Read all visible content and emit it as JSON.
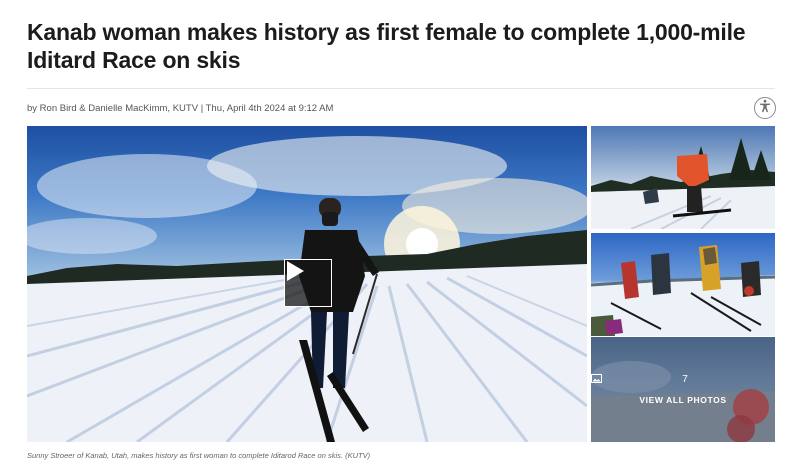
{
  "article": {
    "headline": "Kanab woman makes history as first female to complete 1,000-mile Iditard Race on skis",
    "byline": "by Ron Bird & Danielle MacKimm, KUTV | Thu, April 4th 2024 at 9:12 AM",
    "accessibility_icon": "accessibility-icon"
  },
  "gallery": {
    "main_media": "video",
    "play_icon": "play-icon",
    "photo_count": "7",
    "photo_count_icon": "image-icon",
    "view_all_label": "VIEW ALL PHOTOS",
    "caption": "Sunny Stroeer of Kanab, Utah, makes history as first woman to complete Iditarod Race on skis. (KUTV)"
  }
}
